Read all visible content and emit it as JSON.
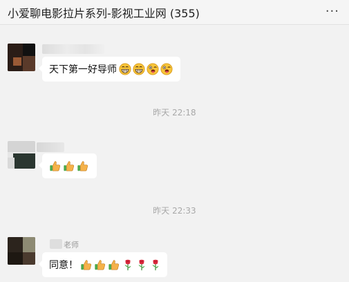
{
  "header": {
    "title": "小爱聊电影拉片系列-影视工业网 (355)",
    "more_icon": "more-dots-icon"
  },
  "messages": [
    {
      "text": "天下第一好导师",
      "emojis": [
        "grin",
        "grin",
        "tongue-wink",
        "tongue-wink"
      ]
    },
    {
      "timestamp": "昨天 22:18"
    },
    {
      "text": "",
      "emojis": [
        "thumbs-up",
        "thumbs-up",
        "thumbs-up"
      ]
    },
    {
      "timestamp": "昨天 22:33"
    },
    {
      "sender_name": "老师",
      "text": "同意！",
      "emojis": [
        "thumbs-up",
        "thumbs-up",
        "thumbs-up",
        "rose",
        "rose",
        "rose"
      ]
    }
  ],
  "colors": {
    "background": "#f2f2f2",
    "bubble": "#ffffff",
    "timestamp": "#a8a8a8"
  }
}
